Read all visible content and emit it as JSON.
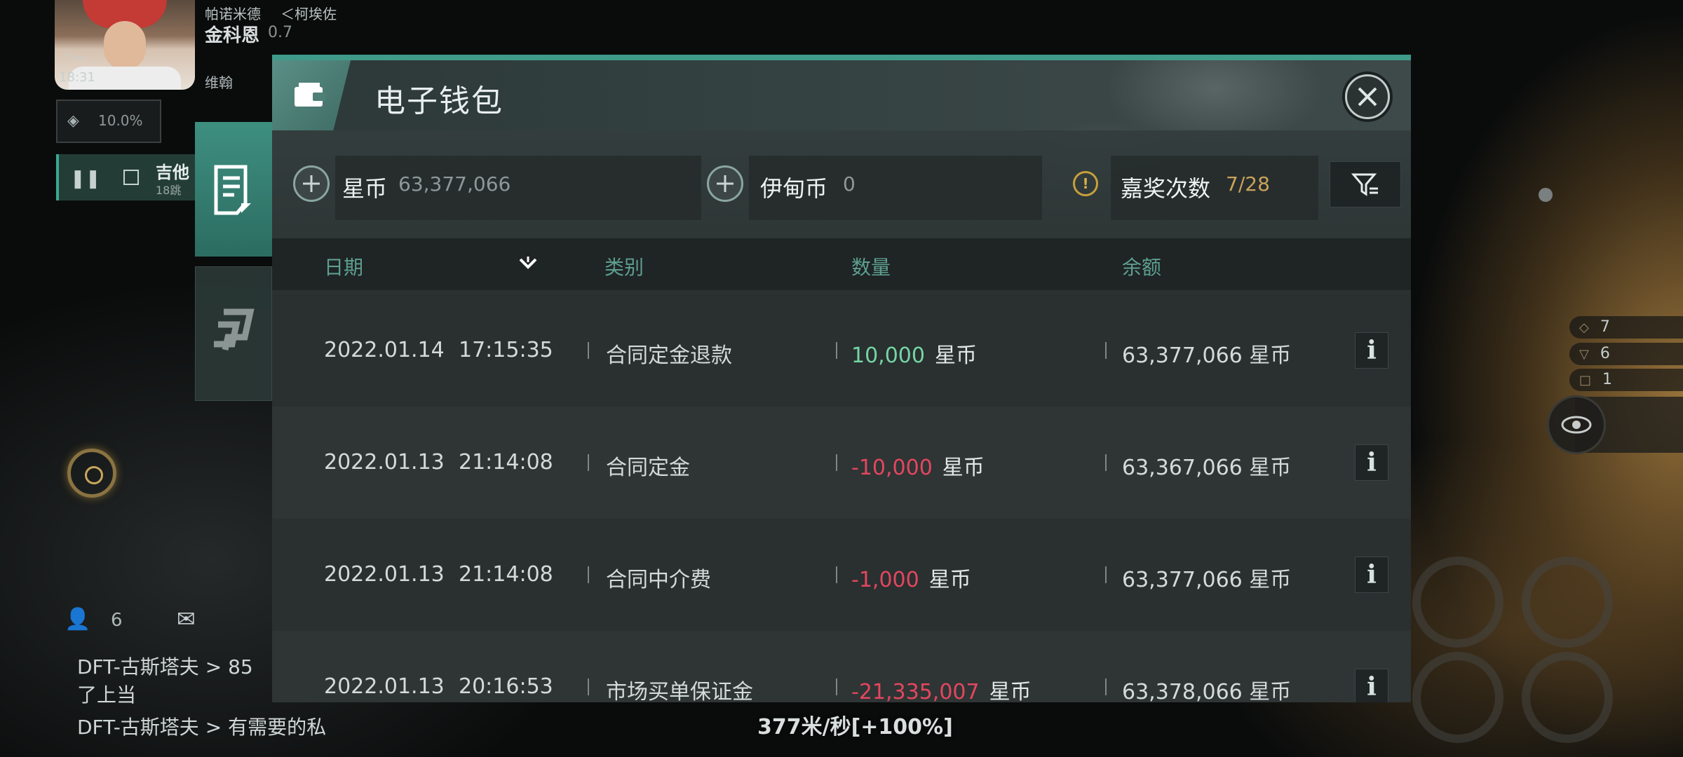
{
  "hud": {
    "system_name": "帕诺米德",
    "region": "＜柯埃佐",
    "player_name": "金科恩",
    "security": "0.7",
    "time": "18:31",
    "sub_label": "维翰",
    "cargo_percent": "10.0%",
    "route_name": "吉他",
    "route_jumps": "18跳",
    "chat_member_count": "6",
    "chat_lines": [
      "DFT-古斯塔夫 > 85",
      "了上当",
      "DFT-古斯塔夫 > 有需要的私"
    ],
    "speed": "377米/秒[+100%]",
    "right_stats": [
      {
        "icon": "◇",
        "value": "7"
      },
      {
        "icon": "▽",
        "value": "6"
      },
      {
        "icon": "□",
        "value": "1"
      }
    ]
  },
  "wallet": {
    "title": "电子钱包",
    "balances": {
      "star_coin_label": "星币",
      "star_coin_value": "63,377,066",
      "eden_coin_label": "伊甸币",
      "eden_coin_value": "0",
      "reward_label": "嘉奖次数",
      "reward_value": "7/28"
    },
    "columns": {
      "date": "日期",
      "category": "类别",
      "amount": "数量",
      "balance": "余额"
    },
    "rows": [
      {
        "date": "2022.01.14",
        "time": "17:15:35",
        "category": "合同定金退款",
        "amount": "10,000",
        "amount_unit": "星币",
        "balance": "63,377,066 星币"
      },
      {
        "date": "2022.01.13",
        "time": "21:14:08",
        "category": "合同定金",
        "amount": "-10,000",
        "amount_unit": "星币",
        "balance": "63,367,066 星币"
      },
      {
        "date": "2022.01.13",
        "time": "21:14:08",
        "category": "合同中介费",
        "amount": "-1,000",
        "amount_unit": "星币",
        "balance": "63,377,066 星币"
      },
      {
        "date": "2022.01.13",
        "time": "20:16:53",
        "category": "市场买单保证金",
        "amount": "-21,335,007",
        "amount_unit": "星币",
        "balance": "63,378,066 星币"
      }
    ],
    "colors": {
      "positive": "#74d5a6",
      "negative": "#e2475f",
      "accent": "#3f9a8a",
      "header_text": "#5d9f90",
      "reward_value": "#c9a35a"
    }
  }
}
